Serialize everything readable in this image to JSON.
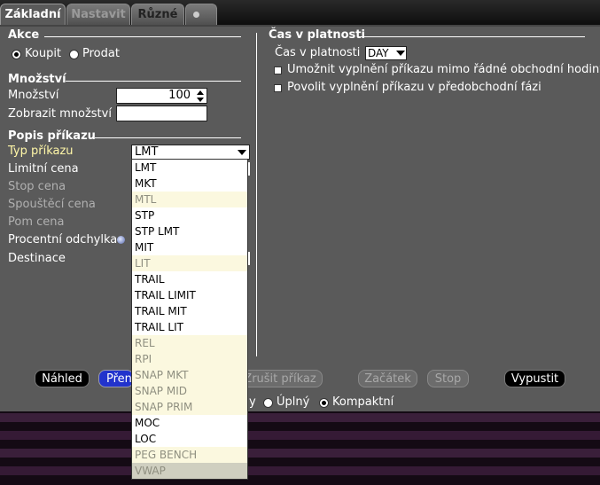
{
  "tabs": [
    {
      "label": "Základní"
    },
    {
      "label": "Nastavit"
    },
    {
      "label": "Různé"
    }
  ],
  "akce": {
    "title": "Akce",
    "buy": "Koupit",
    "sell": "Prodat"
  },
  "mnozstvi": {
    "title": "Množství",
    "quantity_label": "Množství",
    "quantity_value": "100",
    "display_label": "Zobrazit množství",
    "display_value": ""
  },
  "popis": {
    "title": "Popis příkazu",
    "type_label": "Typ příkazu",
    "type_value": "LMT",
    "limit_label": "Limitní cena",
    "stop_label": "Stop cena",
    "trigger_label": "Spouštěcí cena",
    "aux_label": "Pom cena",
    "pct_label": "Procentní odchylka",
    "dest_label": "Destinace"
  },
  "validity": {
    "title": "Čas v platnosti",
    "tif_label": "Čas v platnosti",
    "tif_value": "DAY",
    "outside_rth": "Umožnit vyplnění příkazu mimo řádné obchodní hodiny",
    "premarket": "Povolit vyplnění příkazu v předobchodní fázi"
  },
  "buttons": {
    "preview": "Náhled",
    "transmit_partial": "Přen",
    "cancel": "Zrušit příkaz",
    "start": "Začátek",
    "stop": "Stop",
    "release": "Vypustit"
  },
  "view": {
    "partial": "y",
    "full": "Úplný",
    "compact": "Kompaktní"
  },
  "order_types": [
    {
      "label": "LMT",
      "enabled": true
    },
    {
      "label": "MKT",
      "enabled": true
    },
    {
      "label": "MTL",
      "enabled": false
    },
    {
      "label": "STP",
      "enabled": true
    },
    {
      "label": "STP LMT",
      "enabled": true
    },
    {
      "label": "MIT",
      "enabled": true
    },
    {
      "label": "LIT",
      "enabled": false
    },
    {
      "label": "TRAIL",
      "enabled": true
    },
    {
      "label": "TRAIL LIMIT",
      "enabled": true
    },
    {
      "label": "TRAIL MIT",
      "enabled": true
    },
    {
      "label": "TRAIL LIT",
      "enabled": true
    },
    {
      "label": "REL",
      "enabled": false
    },
    {
      "label": "RPI",
      "enabled": false
    },
    {
      "label": "SNAP MKT",
      "enabled": false
    },
    {
      "label": "SNAP MID",
      "enabled": false
    },
    {
      "label": "SNAP PRIM",
      "enabled": false
    },
    {
      "label": "MOC",
      "enabled": true
    },
    {
      "label": "LOC",
      "enabled": true
    },
    {
      "label": "PEG BENCH",
      "enabled": false
    },
    {
      "label": "VWAP",
      "enabled": false
    }
  ]
}
